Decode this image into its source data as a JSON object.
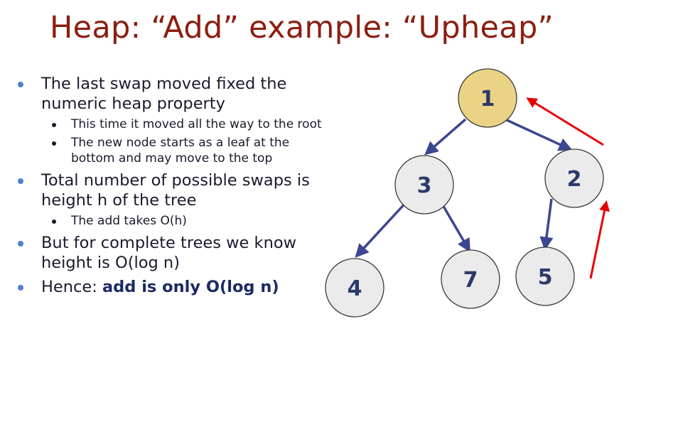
{
  "slide": {
    "title": "Heap: “Add” example: “Upheap”",
    "bullets": [
      {
        "text": "The last swap moved fixed the numeric heap property",
        "sub": [
          "This time it moved all the way to the root",
          "The new node starts as a leaf at the bottom and may move to the top"
        ]
      },
      {
        "text": "Total number of possible swaps is height h of the tree",
        "sub": [
          "The add takes O(h)"
        ]
      },
      {
        "text": "But for complete trees we know height is O(log n)",
        "sub": []
      },
      {
        "text_prefix": "Hence: ",
        "text_bold": "add is only O(log n)",
        "sub": []
      }
    ]
  },
  "tree": {
    "nodes": [
      {
        "id": "root",
        "label": "1",
        "highlighted": true
      },
      {
        "id": "left",
        "label": "3",
        "highlighted": false
      },
      {
        "id": "right",
        "label": "2",
        "highlighted": false
      },
      {
        "id": "left-left",
        "label": "4",
        "highlighted": false
      },
      {
        "id": "left-right",
        "label": "7",
        "highlighted": false
      },
      {
        "id": "right-left",
        "label": "5",
        "highlighted": false
      }
    ],
    "colors": {
      "node_fill": "#ebebeb",
      "node_stroke": "#3b3b3b",
      "highlight_fill": "#ead384",
      "edge": "#3d4690",
      "upheap_arrow": "#e50000",
      "label": "#2b3a6b"
    }
  }
}
